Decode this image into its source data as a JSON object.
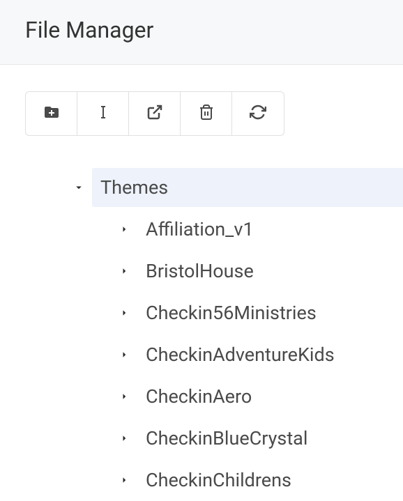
{
  "header": {
    "title": "File Manager"
  },
  "toolbar": {
    "buttons": [
      {
        "name": "new-folder",
        "icon": "folder-plus"
      },
      {
        "name": "rename",
        "icon": "text-cursor"
      },
      {
        "name": "open-external",
        "icon": "external-link"
      },
      {
        "name": "delete",
        "icon": "trash"
      },
      {
        "name": "refresh",
        "icon": "refresh"
      }
    ]
  },
  "tree": {
    "root": {
      "label": "Themes",
      "expanded": true,
      "selected": true
    },
    "children": [
      {
        "label": "Affiliation_v1"
      },
      {
        "label": "BristolHouse"
      },
      {
        "label": "Checkin56Ministries"
      },
      {
        "label": "CheckinAdventureKids"
      },
      {
        "label": "CheckinAero"
      },
      {
        "label": "CheckinBlueCrystal"
      },
      {
        "label": "CheckinChildrens"
      }
    ]
  }
}
